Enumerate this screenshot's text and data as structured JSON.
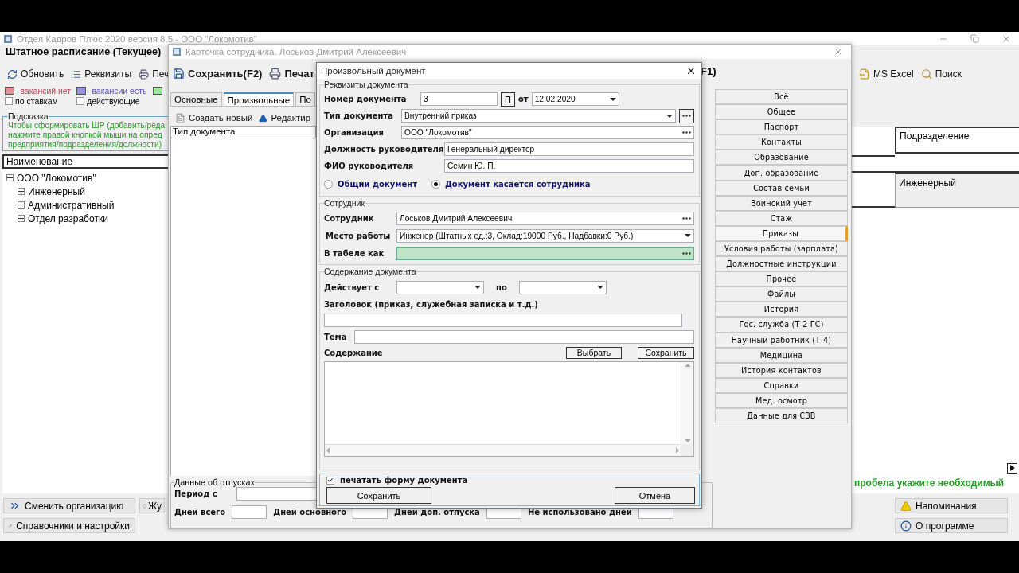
{
  "main_window": {
    "title": "Отдел Кадров Плюс 2020 версия 8.5 - ООО \"Локомотив\"",
    "heading": "Штатное расписание (Текущее)",
    "toolbar": [
      "Обновить",
      "Реквизиты",
      "Печ"
    ],
    "toolbar_right": [
      "MS Excel",
      "Поиск"
    ],
    "legend": [
      {
        "label": "- вакансий нет",
        "color": "#e8909a"
      },
      {
        "label": "- вакансии есть",
        "color": "#9a90e0"
      },
      {
        "color": "#9ee89a"
      }
    ],
    "filters": [
      {
        "label": "по ставкам",
        "checked": false
      },
      {
        "label": "действующие",
        "checked": false
      }
    ],
    "hint": {
      "title": "Подсказка",
      "lines": [
        "Чтобы сформировать ШР (добавить/реда",
        "нажмите правой кнопкой мыши на опред",
        "предприятия/подразделения/должности)"
      ]
    },
    "tree": {
      "header": "Наименование",
      "items": [
        {
          "label": "ООО \"Локомотив\"",
          "expanded": true,
          "children": [
            {
              "label": "Инженерный",
              "expanded": false
            },
            {
              "label": "Административный",
              "expanded": false
            },
            {
              "label": "Отдел разработки",
              "expanded": false
            }
          ]
        }
      ]
    },
    "table": {
      "columns": [
        "Подразделение"
      ],
      "rows": [
        [
          "Инженерный"
        ]
      ]
    },
    "hint_right": "пробела укажите необходимый",
    "buttons_left": [
      "Сменить организацию",
      "Жу",
      "Справочники и настройки"
    ],
    "buttons_right": [
      "Напоминания",
      "О программе"
    ]
  },
  "card": {
    "title": "Карточка сотрудника. Лоськов Дмитрий Алексеевич",
    "toolbar": [
      "Сохранить(F2)",
      "Печат"
    ],
    "toolbar_right": "F1)",
    "tabs": [
      {
        "label": "Основные",
        "selected": false
      },
      {
        "label": "Произвольные",
        "selected": true
      },
      {
        "label": "По",
        "selected": false
      }
    ],
    "actions": [
      "Создать новый",
      "Редактир"
    ],
    "list_header": "Тип документа",
    "nav": [
      {
        "label": "Всё",
        "selected": false
      },
      {
        "label": "Общее",
        "selected": false
      },
      {
        "label": "Паспорт",
        "selected": false
      },
      {
        "label": "Контакты",
        "selected": false
      },
      {
        "label": "Образование",
        "selected": false
      },
      {
        "label": "Доп. образование",
        "selected": false
      },
      {
        "label": "Состав семьи",
        "selected": false
      },
      {
        "label": "Воинский учет",
        "selected": false
      },
      {
        "label": "Стаж",
        "selected": false
      },
      {
        "label": "Приказы",
        "selected": true
      },
      {
        "label": "Условия работы (зарплата)",
        "selected": false
      },
      {
        "label": "Должностные инструкции",
        "selected": false
      },
      {
        "label": "Прочее",
        "selected": false
      },
      {
        "label": "Файлы",
        "selected": false
      },
      {
        "label": "История",
        "selected": false
      },
      {
        "label": "Гос. служба (Т-2 ГС)",
        "selected": false
      },
      {
        "label": "Научный работник (Т-4)",
        "selected": false
      },
      {
        "label": "Медицина",
        "selected": false
      },
      {
        "label": "История контактов",
        "selected": false
      },
      {
        "label": "Справки",
        "selected": false
      },
      {
        "label": "Мед. осмотр",
        "selected": false
      },
      {
        "label": "Данные для СЗВ",
        "selected": false
      }
    ],
    "vacation": {
      "title": "Данные об отпусках",
      "period_label": "Период с",
      "fields": [
        "Дней всего",
        "Дней основного",
        "Дней доп. отпуска",
        "Не использовано дней"
      ]
    }
  },
  "dialog": {
    "title": "Произвольный документ",
    "requisites": {
      "title": "Реквизиты документа",
      "number_label": "Номер документа",
      "number": "3",
      "p_button": "П",
      "date_label": "от",
      "date": "12.02.2020",
      "type_label": "Тип документа",
      "type": "Внутренний приказ",
      "org_label": "Организация",
      "org": "ООО \"Локомотив\"",
      "head_position_label": "Должность руководителя",
      "head_position": "Генеральный директор",
      "head_name_label": "ФИО руководителя",
      "head_name": "Семин Ю. П.",
      "scope": [
        {
          "label": "Общий документ",
          "selected": false
        },
        {
          "label": "Документ касается сотрудника",
          "selected": true
        }
      ]
    },
    "employee": {
      "title": "Сотрудник",
      "employee_label": "Сотрудник",
      "employee": "Лоськов Дмитрий Алексеевич",
      "workplace_label": "Место работы",
      "workplace": "Инженер (Штатных ед.:3, Оклад:19000 Руб., Надбавки:0 Руб.)",
      "timesheet_label": "В табеле как",
      "timesheet_focused": true
    },
    "content": {
      "title": "Содержание документа",
      "valid_from_label": "Действует с",
      "valid_to_label": "по",
      "heading_label": "Заголовок (приказ, служебная записка и т.д.)",
      "subject_label": "Тема",
      "body_label": "Содержание",
      "buttons": [
        "Выбрать",
        "Сохранить"
      ]
    },
    "print_form": {
      "label": "печатать форму документа",
      "checked": true
    },
    "buttons": [
      "Сохранить",
      "Отмена"
    ]
  }
}
